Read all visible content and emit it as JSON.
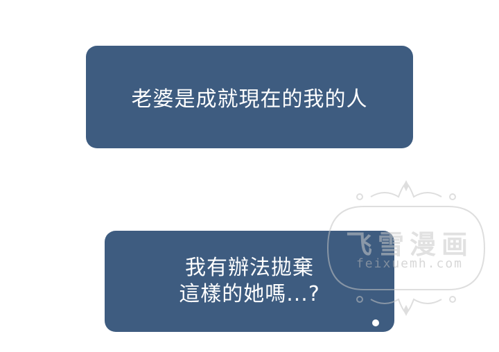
{
  "captions": [
    {
      "lines": [
        "老婆是成就現在的我的人"
      ]
    },
    {
      "lines": [
        "我有辦法拋棄",
        "這樣的她嗎...?"
      ]
    }
  ],
  "watermark": {
    "title": "飞雪漫画",
    "url": "feixuemh.com"
  },
  "colors": {
    "caption_background": "#3e5c80",
    "caption_text": "#ffffff",
    "page_background": "#ffffff",
    "watermark": "#c9c9c9"
  }
}
